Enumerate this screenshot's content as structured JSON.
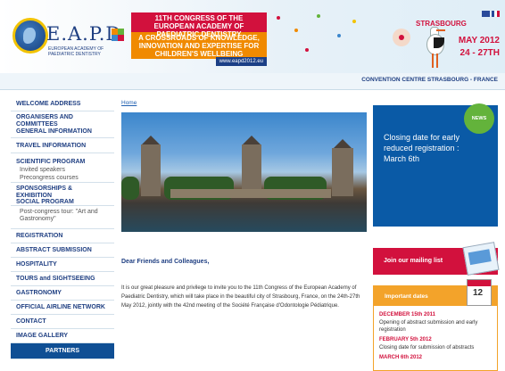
{
  "header": {
    "logo_text": "E.A.P.D",
    "logo_subtitle": "EUROPEAN ACADEMY OF PAEDIATRIC DENTISTRY",
    "congress_line1": "11TH CONGRESS OF THE EUROPEAN ACADEMY OF PAEDIATRIC DENTISTRY",
    "congress_line2": "A CROSSROADS OF KNOWLEDGE, INNOVATION AND EXPERTISE FOR CHILDREN'S WELLBEING",
    "congress_url": "www.eapd2012.eu",
    "city": "STRASBOURG",
    "date_line1": "MAY 2012",
    "date_line2": "24 - 27TH",
    "venue": "CONVENTION CENTRE STRASBOURG - FRANCE"
  },
  "sidebar": {
    "items": [
      {
        "label": "WELCOME ADDRESS"
      },
      {
        "label": "ORGANISERS AND COMMITTEES"
      },
      {
        "label": "GENERAL INFORMATION"
      },
      {
        "label": "TRAVEL INFORMATION"
      },
      {
        "label": "SCIENTIFIC PROGRAM"
      },
      {
        "label": "Invited speakers"
      },
      {
        "label": "Precongress courses"
      },
      {
        "label": "SPONSORSHIPS & EXHIBITION"
      },
      {
        "label": "SOCIAL PROGRAM"
      },
      {
        "label": "Post-congress tour: \"Art and Gastronomy\""
      },
      {
        "label": "REGISTRATION"
      },
      {
        "label": "ABSTRACT SUBMISSION"
      },
      {
        "label": "HOSPITALITY"
      },
      {
        "label": "TOURS and SIGHTSEEING"
      },
      {
        "label": "GASTRONOMY"
      },
      {
        "label": "OFFICIAL AIRLINE NETWORK"
      },
      {
        "label": "CONTACT"
      },
      {
        "label": "IMAGE GALLERY"
      }
    ],
    "partners_label": "PARTNERS"
  },
  "main": {
    "breadcrumb": "Home",
    "greeting": "Dear Friends and Colleagues,",
    "intro": "It is our great pleasure and privilege to invite you to the 11th Congress of the European Academy of Paediatric Dentistry, which will take place in the beautiful city of Strasbourg, France, on the 24th-27th May 2012, jointly with the 42nd meeting of the Société Française d'Odontologie Pédiatrique."
  },
  "right": {
    "news_badge": "NEWS",
    "news_text": "Closing date for early reduced registration : March 6th",
    "mailing_label": "Join our mailing list",
    "important_title": "Important dates",
    "calendar_number": "12",
    "dates": [
      {
        "date": "DECEMBER 15th 2011",
        "desc": "Opening of abstract submission and early registration"
      },
      {
        "date": "FEBRUARY 5th 2012",
        "desc": "Closing date for submission of abstracts"
      },
      {
        "date": "MARCH 6th 2012",
        "desc": ""
      }
    ]
  },
  "colors": {
    "navy": "#1f3f82",
    "red": "#d2113d",
    "orange": "#f08a00",
    "blue": "#0a5aa6",
    "green": "#63b33b"
  }
}
